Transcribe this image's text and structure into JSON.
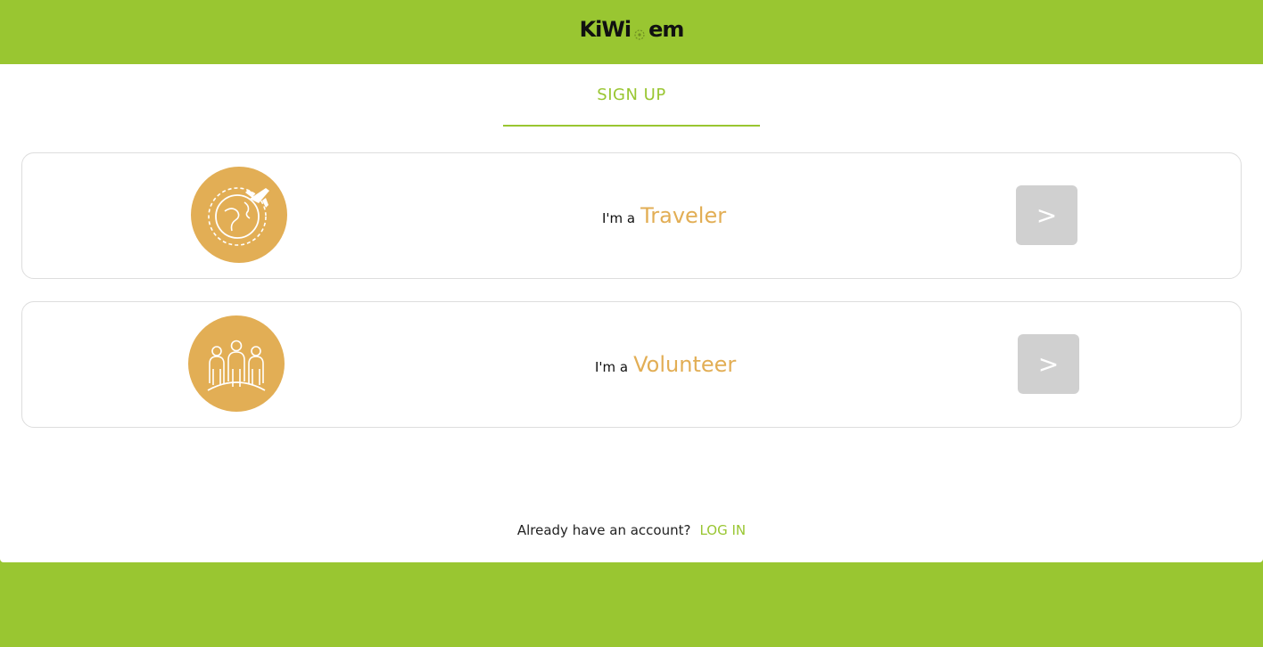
{
  "header": {
    "logo_text_left": "KiWi",
    "logo_text_right": "em",
    "logo_icon": "kiwi-logo-icon"
  },
  "tabs": {
    "signup_label": "SIGN UP"
  },
  "roles": [
    {
      "prefix": "I'm a",
      "name": "Traveler",
      "icon": "globe-plane-icon",
      "action": ">"
    },
    {
      "prefix": "I'm a",
      "name": "Volunteer",
      "icon": "volunteers-group-icon",
      "action": ">"
    }
  ],
  "footer": {
    "question": "Already have an account?",
    "login_label": "LOG IN"
  },
  "colors": {
    "brand_green": "#99c631",
    "accent_gold": "#e2ae55",
    "button_gray": "#d0d0d0"
  }
}
